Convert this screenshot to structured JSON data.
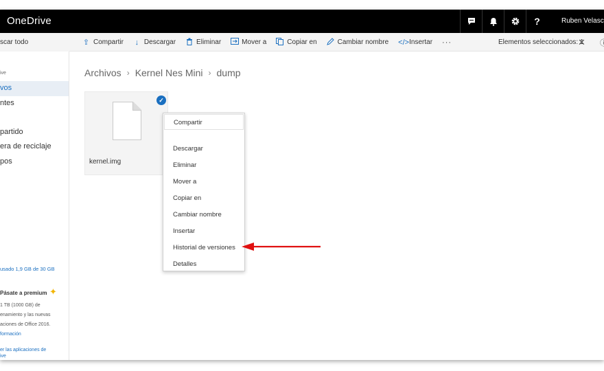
{
  "app": {
    "title": "OneDrive"
  },
  "topbar": {
    "icons": [
      "chat-icon",
      "bell-icon",
      "gear-icon",
      "help-icon"
    ],
    "help_label": "?",
    "user_name": "Ruben Velasco"
  },
  "commandbar": {
    "search_label": "scar todo",
    "items": [
      {
        "icon": "share-icon",
        "label": "Compartir"
      },
      {
        "icon": "download-icon",
        "label": "Descargar"
      },
      {
        "icon": "trash-icon",
        "label": "Eliminar"
      },
      {
        "icon": "move-icon",
        "label": "Mover a"
      },
      {
        "icon": "copy-icon",
        "label": "Copiar en"
      },
      {
        "icon": "rename-icon",
        "label": "Cambiar nombre"
      },
      {
        "icon": "embed-icon",
        "label": "Insertar"
      }
    ],
    "more_label": "···",
    "selected_count": "Elementos seleccionados: 1"
  },
  "sidebar": {
    "small_label": "ive",
    "items": [
      {
        "label": "vos",
        "active": true
      },
      {
        "label": "ntes",
        "active": false
      },
      {
        "label": "partido",
        "active": false
      },
      {
        "label": "era de reciclaje",
        "active": false
      },
      {
        "label": "pos",
        "active": false
      }
    ],
    "storage": "usado 1,9 GB de 30 GB",
    "premium": {
      "title": "Pásate a premium",
      "lines": [
        "1 TB (1000 GB) de",
        "enamiento y las nuevas",
        "aciones de Office 2016."
      ],
      "info_link": "formación",
      "apps_link_1": "er las aplicaciones de",
      "apps_link_2": "ive"
    }
  },
  "breadcrumb": [
    "Archivos",
    "Kernel Nes Mini",
    "dump"
  ],
  "file": {
    "name": "kernel.img",
    "selected": true
  },
  "context_menu": {
    "items": [
      "Compartir",
      "Descargar",
      "Eliminar",
      "Mover a",
      "Copiar en",
      "Cambiar nombre",
      "Insertar",
      "Historial de versiones",
      "Detalles"
    ]
  },
  "colors": {
    "accent": "#1a6fc0",
    "topbar": "#000000",
    "annotation_arrow": "#e01010"
  }
}
